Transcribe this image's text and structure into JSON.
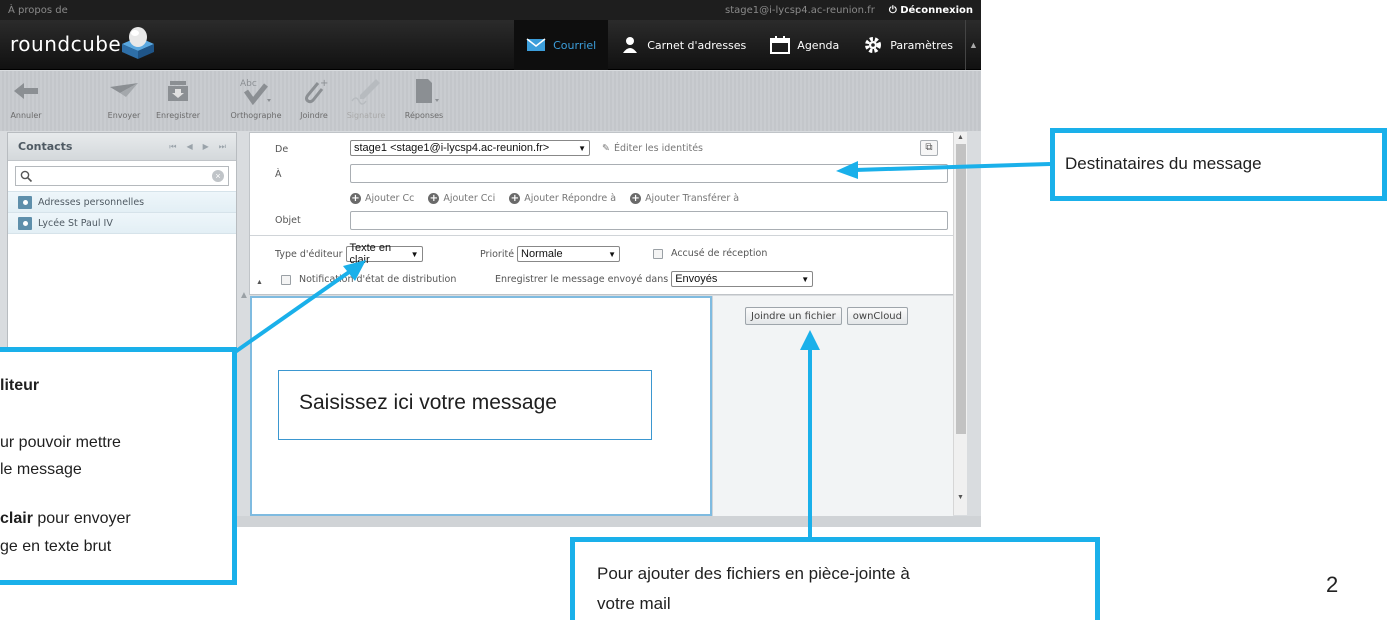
{
  "topbar": {
    "about": "À propos de",
    "user_email": "stage1@i-lycsp4.ac-reunion.fr",
    "logout": "Déconnexion"
  },
  "logo": {
    "text": "roundcube"
  },
  "nav": {
    "mail": "Courriel",
    "addressbook": "Carnet d'adresses",
    "calendar": "Agenda",
    "settings": "Paramètres"
  },
  "toolbar": {
    "cancel": "Annuler",
    "send": "Envoyer",
    "save": "Enregistrer",
    "spell": "Orthographe",
    "attach": "Joindre",
    "signature": "Signature",
    "responses": "Réponses"
  },
  "contacts": {
    "title": "Contacts",
    "search_placeholder": "",
    "groups": [
      "Adresses personnelles",
      "Lycée St Paul IV"
    ]
  },
  "compose": {
    "from_label": "De",
    "from_value": "stage1 <stage1@i-lycsp4.ac-reunion.fr>",
    "edit_identities": "Éditer les identités",
    "to_label": "À",
    "add_cc": "Ajouter Cc",
    "add_bcc": "Ajouter Cci",
    "add_reply_to": "Ajouter Répondre à",
    "add_followup": "Ajouter Transférer à",
    "subject_label": "Objet",
    "editor_type_label": "Type d'éditeur",
    "editor_type_value": "Texte en clair",
    "priority_label": "Priorité",
    "priority_value": "Normale",
    "receipt_label": "Accusé de réception",
    "dsn_label": "Notification d'état de distribution",
    "save_sent_label": "Enregistrer le message envoyé dans",
    "save_sent_value": "Envoyés"
  },
  "attachments": {
    "attach_file": "Joindre un fichier",
    "owncloud": "ownCloud"
  },
  "annotations": {
    "recipients": "Destinataires du message",
    "body": "Saisissez ici votre message",
    "attach_help_line1": "Pour ajouter des fichiers en pièce-jointe à",
    "attach_help_line2": "votre mail",
    "editor_title": "liteur",
    "editor_line1": "ur pouvoir mettre",
    "editor_line2": "le message",
    "editor_line3_bold": "clair",
    "editor_line3_rest": " pour envoyer",
    "editor_line4": "ge en texte brut"
  },
  "page_number": "2",
  "colors": {
    "accent": "#1ab0ea",
    "header": "#1e1e1e",
    "nav_active_text": "#3c9edb"
  }
}
